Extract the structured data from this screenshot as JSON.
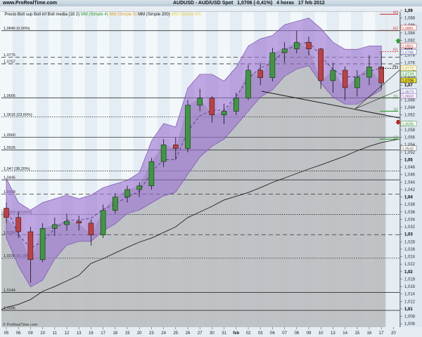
{
  "header": {
    "site": "www.ProRealTime.com",
    "title": "AUDUSD - AUD/USD Spot   1,0706 (-0,41%)   4 horas   17 feb 2012"
  },
  "legend": [
    {
      "text": "Precio Boll sup Boll inf Boll media (18 2) ",
      "color": "#111111"
    },
    {
      "text": "MM (Simple 4) ",
      "color": "#2e9a2e"
    },
    {
      "text": "MM (Simple 5) ",
      "color": "#e0a020"
    },
    {
      "text": "MM (Simple 200) ",
      "color": "#111111"
    },
    {
      "text": "MM (Simple 60)",
      "color": "#e8d040"
    }
  ],
  "watermark": "© ProRealTime.com",
  "colors": {
    "band": "#9a6fd0",
    "up": "#3c9a3c",
    "down": "#c04040",
    "area": "#b9bcc0",
    "ma200": "#222222",
    "ma_orange": "#e8a040"
  },
  "chart_data": {
    "type": "candlestick",
    "title": "AUDUSD - AUD/USD Spot",
    "ylim": [
      1.005,
      1.091
    ],
    "x": [
      "05",
      "06",
      "09",
      "10",
      "11",
      "12",
      "13",
      "16",
      "17",
      "18",
      "19",
      "20",
      "23",
      "24",
      "25",
      "26",
      "27",
      "30",
      "31",
      "feb",
      "02",
      "03",
      "06",
      "07",
      "08",
      "09",
      "10",
      "13",
      "14",
      "15",
      "16",
      "17",
      "20"
    ],
    "ohlc": [
      [
        1.037,
        1.0385,
        1.033,
        1.0345
      ],
      [
        1.0345,
        1.036,
        1.029,
        1.0307
      ],
      [
        1.0307,
        1.032,
        1.017,
        1.0232
      ],
      [
        1.0232,
        1.033,
        1.0225,
        1.0316
      ],
      [
        1.0316,
        1.0345,
        1.0295,
        1.0326
      ],
      [
        1.0326,
        1.0355,
        1.031,
        1.0335
      ],
      [
        1.0335,
        1.035,
        1.031,
        1.033
      ],
      [
        1.033,
        1.034,
        1.027,
        1.0298
      ],
      [
        1.0298,
        1.038,
        1.029,
        1.0364
      ],
      [
        1.0364,
        1.041,
        1.0355,
        1.04
      ],
      [
        1.04,
        1.043,
        1.0385,
        1.042
      ],
      [
        1.042,
        1.044,
        1.04,
        1.043
      ],
      [
        1.043,
        1.0505,
        1.042,
        1.0495
      ],
      [
        1.0495,
        1.0555,
        1.048,
        1.054
      ],
      [
        1.054,
        1.056,
        1.05,
        1.053
      ],
      [
        1.053,
        1.066,
        1.052,
        1.0646
      ],
      [
        1.0646,
        1.069,
        1.063,
        1.0665
      ],
      [
        1.0665,
        1.067,
        1.06,
        1.062
      ],
      [
        1.062,
        1.065,
        1.0595,
        1.063
      ],
      [
        1.063,
        1.068,
        1.062,
        1.0665
      ],
      [
        1.0665,
        1.0755,
        1.066,
        1.074
      ],
      [
        1.074,
        1.076,
        1.07,
        1.072
      ],
      [
        1.072,
        1.08,
        1.071,
        1.0787
      ],
      [
        1.0787,
        1.0815,
        1.076,
        1.0797
      ],
      [
        1.0797,
        1.0846,
        1.0785,
        1.0815
      ],
      [
        1.0815,
        1.083,
        1.078,
        1.0797
      ],
      [
        1.0797,
        1.08,
        1.069,
        1.0712
      ],
      [
        1.0712,
        1.076,
        1.068,
        1.074
      ],
      [
        1.074,
        1.075,
        1.066,
        1.0693
      ],
      [
        1.0693,
        1.074,
        1.067,
        1.0721
      ],
      [
        1.0721,
        1.078,
        1.07,
        1.0749
      ],
      [
        1.0749,
        1.079,
        1.069,
        1.0706
      ],
      null
    ],
    "boll_upper": [
      1.045,
      1.0385,
      1.0365,
      1.0385,
      1.0395,
      1.0405,
      1.0395,
      1.0405,
      1.0425,
      1.0435,
      1.0445,
      1.0465,
      1.055,
      1.0597,
      1.0588,
      1.0692,
      1.0729,
      1.0729,
      1.0711,
      1.0748,
      1.0805,
      1.0824,
      1.0833,
      1.0862,
      1.0871,
      1.088,
      1.0852,
      1.0815,
      1.0796,
      1.0796,
      1.0805,
      1.0805,
      null
    ],
    "boll_lower": [
      1.029,
      1.0215,
      1.0159,
      1.0177,
      1.0234,
      1.0271,
      1.0281,
      1.0281,
      1.0309,
      1.0328,
      1.0356,
      1.0365,
      1.0384,
      1.0403,
      1.0413,
      1.0461,
      1.0507,
      1.0536,
      1.0555,
      1.0592,
      1.063,
      1.0668,
      1.0687,
      1.0724,
      1.0743,
      1.0752,
      1.0705,
      1.0668,
      1.0649,
      1.0649,
      1.0668,
      1.0687,
      null
    ],
    "ma200": [
      1.0104,
      1.0112,
      1.0125,
      1.0147,
      1.016,
      1.0175,
      1.019,
      1.0222,
      1.0235,
      1.025,
      1.0265,
      1.0279,
      1.029,
      1.0305,
      1.032,
      1.0345,
      1.036,
      1.0375,
      1.0392,
      1.0402,
      1.0412,
      1.0425,
      1.0439,
      1.0451,
      1.0463,
      1.0475,
      1.0486,
      1.0498,
      1.051,
      1.0524,
      1.0536,
      1.0546,
      null
    ],
    "y_ticks": [
      "1,09",
      "1,088",
      "1,086",
      "1,084",
      "1,082",
      "1,08",
      "1,078",
      "1,076",
      "1,074",
      "1,072",
      "1,07",
      "1,068",
      "1,066",
      "1,064",
      "1,062",
      "1,06",
      "1,058",
      "1,056",
      "1,054",
      "1,052",
      "1,05",
      "1,048",
      "1,046",
      "1,044",
      "1,042",
      "1,04",
      "1,038",
      "1,036",
      "1,034",
      "1,032",
      "1,03",
      "1,028",
      "1,026",
      "1,024",
      "1,022",
      "1,02",
      "1,018",
      "1,016",
      "1,014",
      "1,012",
      "1,01",
      "1,008",
      "1,006"
    ],
    "levels": [
      {
        "value": 1.0846,
        "label": "1,0846 (0,00%)",
        "style": "solid"
      },
      {
        "value": 1.0775,
        "label": "1,0775",
        "style": "dashed"
      },
      {
        "value": 1.0757,
        "label": "1,0757",
        "style": "dashed"
      },
      {
        "value": 1.0666,
        "label": "1,0666",
        "style": "solid"
      },
      {
        "value": 1.0615,
        "label": "1,0615 (23,60%)",
        "style": "dotted"
      },
      {
        "value": 1.056,
        "label": "1,0560",
        "style": "solid"
      },
      {
        "value": 1.0526,
        "label": "1,0526",
        "style": "solid"
      },
      {
        "value": 1.047,
        "label": "1,047 (38,20%)",
        "style": "dotted"
      },
      {
        "value": 1.0446,
        "label": "1,0446",
        "style": "solid"
      },
      {
        "value": 1.0408,
        "label": "1,0408",
        "style": "dashed"
      },
      {
        "value": 1.0353,
        "label": "1,0353 (50,00%)",
        "style": "dotted"
      },
      {
        "value": 1.0299,
        "label": "1,0299",
        "style": "dashed"
      },
      {
        "value": 1.0236,
        "label": "1,0236 (61,80%)",
        "style": "dotted"
      },
      {
        "value": 1.0144,
        "label": "1,0144",
        "style": "solid"
      },
      {
        "value": 1.0096,
        "label": "1,0096",
        "style": "solid"
      }
    ],
    "pivots": [
      {
        "name": "R3",
        "value": 1.089,
        "color": "#d04040",
        "style": "solid"
      },
      {
        "name": "R2",
        "value": 1.0847,
        "color": "#d04040",
        "style": "dotted"
      },
      {
        "name": "R1",
        "value": 1.079,
        "color": "#d04040",
        "style": "dotted"
      },
      {
        "name": "Piv",
        "value": 1.0745,
        "color": "#111111",
        "style": "dotted"
      },
      {
        "name": "S1",
        "value": 1.0665,
        "color": "#3c9a3c",
        "style": "dotted"
      },
      {
        "name": "S2",
        "value": 1.063,
        "color": "#3c9a3c",
        "style": "solid"
      },
      {
        "name": "S3",
        "value": 1.0555,
        "color": "#3c9a3c",
        "style": "solid"
      }
    ],
    "price_tags": [
      {
        "label": "1,0881",
        "value": 1.0853,
        "color": "#c03030",
        "bg": "#ffffff"
      },
      {
        "label": "1,0801",
        "value": 1.0805,
        "color": "#c03030",
        "bg": "#ffffff"
      },
      {
        "label": "1,0785",
        "value": 1.0788,
        "color": "#5050a0",
        "bg": "#ffffff"
      },
      {
        "label": "1,0772",
        "value": 1.0745,
        "color": "#c0a020",
        "bg": "#fffbe0"
      },
      {
        "label": "1,0724",
        "value": 1.073,
        "color": "#2e8a2e",
        "bg": "#f0fff0"
      },
      {
        "label": "1,0706",
        "value": 1.0712,
        "color": "#000000",
        "bg": "#f0e030"
      },
      {
        "label": "1,0673",
        "value": 1.0682,
        "color": "#5050a0",
        "bg": "#ffffff"
      },
      {
        "label": "1,0663",
        "value": 1.067,
        "color": "#7040a0",
        "bg": "#ffffff"
      },
      {
        "label": "1,0595",
        "value": 1.0596,
        "color": "#2e8a2e",
        "bg": "#ffffff"
      },
      {
        "label": "1,0542",
        "value": 1.053,
        "color": "#555555",
        "bg": "#ffffff"
      }
    ],
    "signals": [
      {
        "type": "buy-arrow",
        "value": 1.0818,
        "color": "#2ea02e"
      },
      {
        "type": "sell-arrow",
        "value": 1.0601,
        "color": "#c02020"
      }
    ]
  }
}
